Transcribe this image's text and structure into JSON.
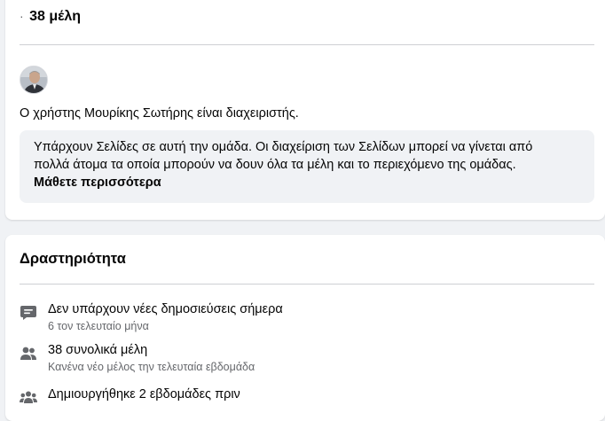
{
  "about": {
    "members_prefix": "·",
    "members_label": "38 μέλη",
    "admin_text": "Ο χρήστης Μουρίκης Σωτήρης είναι διαχειριστής.",
    "pages_info_line1": "Υπάρχουν Σελίδες σε αυτή την ομάδα. Οι διαχείριση των Σελίδων μπορεί να γίνεται από",
    "pages_info_line2": "πολλά άτομα τα οποία μπορούν να δουν όλα τα μέλη και το περιεχόμενο της ομάδας.",
    "learn_more": "Μάθετε περισσότερα"
  },
  "activity": {
    "title": "Δραστηριότητα",
    "items": [
      {
        "icon": "chat-bubble-icon",
        "main": "Δεν υπάρχουν νέες δημοσιεύσεις σήμερα",
        "sub": "6 τον τελευταίο μήνα"
      },
      {
        "icon": "people-icon",
        "main": "38 συνολικά μέλη",
        "sub": "Κανένα νέο μέλος την τελευταία εβδομάδα"
      },
      {
        "icon": "group-icon",
        "main": "Δημιουργήθηκε 2 εβδομάδες πριν",
        "sub": ""
      }
    ]
  },
  "colors": {
    "background": "#f0f2f5",
    "card": "#ffffff",
    "secondary_text": "#65676b",
    "icon": "#65676b"
  }
}
